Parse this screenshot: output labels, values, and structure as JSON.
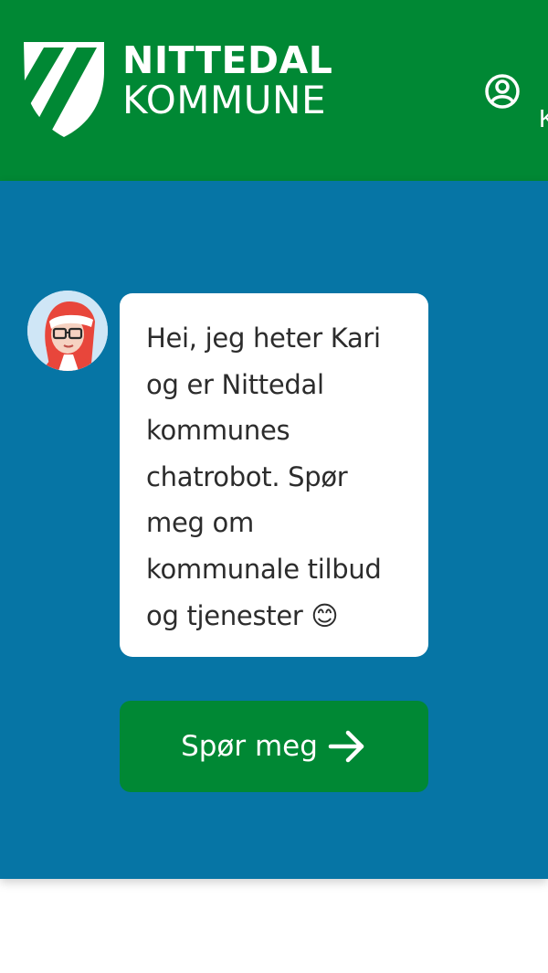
{
  "header": {
    "logo_line1": "NITTEDAL",
    "logo_line2": "KOMMUNE",
    "user_label": "K",
    "background_color": "#008834"
  },
  "hero": {
    "background_color": "#0675a5",
    "avatar_icon": "santa-avatar-icon",
    "message": "Hei, jeg heter Kari og er Nittedal kommunes chatrobot. Spør meg om kommunale tilbud og tjenester 😊",
    "button_label": "Spør meg",
    "button_icon": "arrow-right-icon",
    "button_color": "#008834"
  }
}
